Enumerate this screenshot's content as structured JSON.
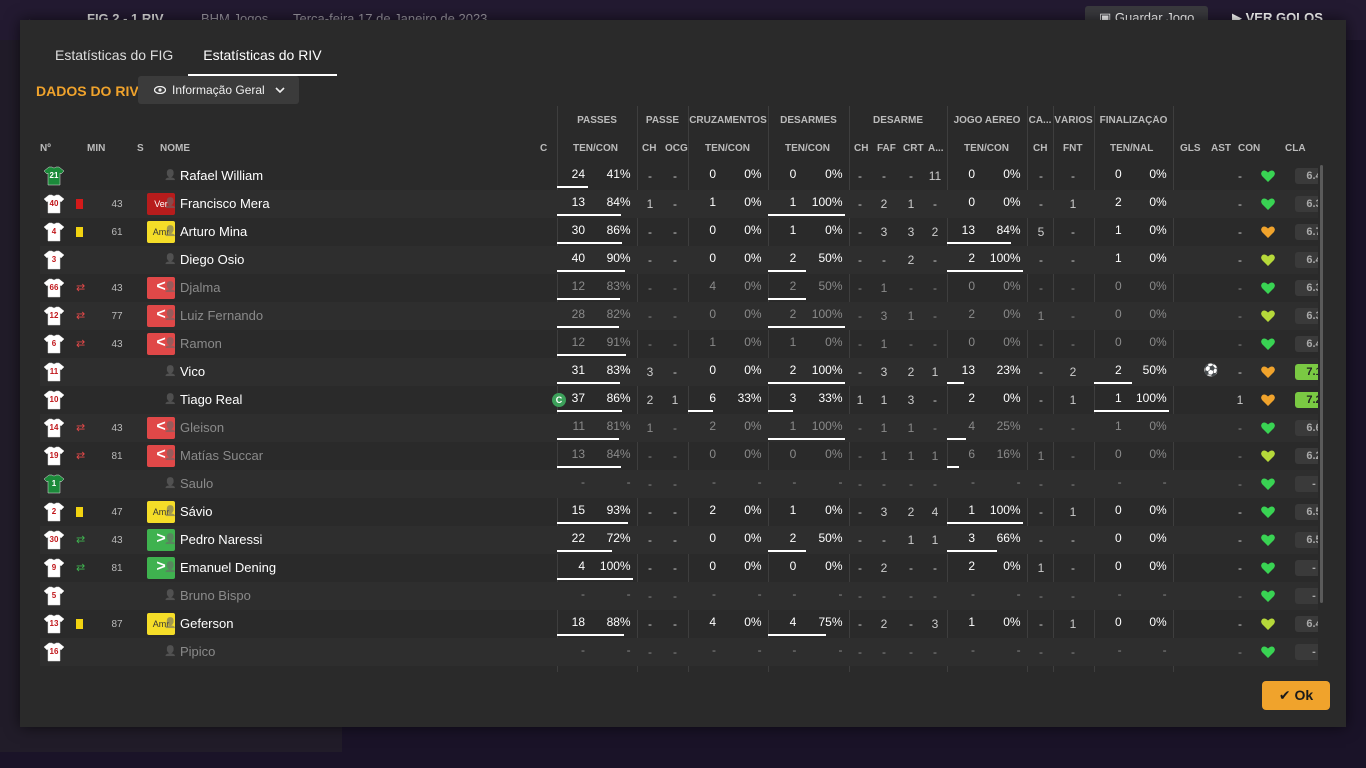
{
  "background": {
    "score": "FIG 2 - 1 RIV",
    "comp": "BHM Jogos",
    "date": "Terça-feira 17 de Janeiro de 2023",
    "save": "Guardar Jogo",
    "goals": "VER GOLOS"
  },
  "tabs": [
    "Estatísticas do FIG",
    "Estatísticas do RIV"
  ],
  "section_title": "DADOS DO RIV",
  "view_dropdown": {
    "label": "Informação Geral"
  },
  "group_headers": {
    "passes": "PASSES",
    "passe": "PASSE",
    "cruzamentos": "CRUZAMENTOS",
    "desarmes": "DESARMES",
    "desarme": "DESARME",
    "jogo_aereo": "JOGO AÉREO",
    "ca": "CA...",
    "varios": "VÁRIOS",
    "finalizacao": "FINALIZAÇÃO"
  },
  "col_headers": {
    "num": "Nº",
    "min": "MIN",
    "s": "S",
    "nome": "NOME",
    "c": "C",
    "passes_tc": "TEN/CON",
    "passe_ch": "CH",
    "passe_ocg": "OCG",
    "cruz_tc": "TEN/CON",
    "des_tc": "TEN/CON",
    "desarme_ch": "CH",
    "faf": "FAF",
    "crt": "CRT",
    "a": "A...",
    "aereo_tc": "TEN/CON",
    "ca_ch": "CH",
    "fnt": "FNT",
    "fin_tn": "TEN/NAL",
    "gls": "GLS",
    "ast": "AST",
    "con": "CON",
    "cla": "CLA"
  },
  "colors": {
    "accent": "#f0a32c",
    "heart_green": "#39d353",
    "heart_lime": "#b6d93a",
    "heart_amber": "#f0a32c"
  },
  "players": [
    {
      "num": "21",
      "gk": true,
      "card": "",
      "sub": "",
      "min": "",
      "badge": "",
      "badge_type": "",
      "name": "Rafael William",
      "dim": false,
      "capt": false,
      "p_ten": "24",
      "p_pct": "41%",
      "p_bar": 0.41,
      "pc": "-",
      "pocg": "-",
      "cr_ten": "0",
      "cr_pct": "0%",
      "cr_bar": 0,
      "de_ten": "0",
      "de_pct": "0%",
      "de_bar": 0,
      "d_ch": "-",
      "faf": "-",
      "crt": "-",
      "a": "11",
      "ae_ten": "0",
      "ae_pct": "0%",
      "ae_bar": 0,
      "ca": "-",
      "fnt": "-",
      "f_ten": "0",
      "f_pct": "0%",
      "f_bar": 0,
      "gls": "",
      "ast": "-",
      "con": "green",
      "cla": "6.4",
      "best": false
    },
    {
      "num": "40",
      "gk": false,
      "card": "red",
      "sub": "",
      "min": "43",
      "badge": "Ver",
      "badge_type": "ver",
      "name": "Francisco Mera",
      "dim": false,
      "capt": false,
      "p_ten": "13",
      "p_pct": "84%",
      "p_bar": 0.84,
      "pc": "1",
      "pocg": "-",
      "cr_ten": "1",
      "cr_pct": "0%",
      "cr_bar": 0,
      "de_ten": "1",
      "de_pct": "100%",
      "de_bar": 1,
      "d_ch": "-",
      "faf": "2",
      "crt": "1",
      "a": "-",
      "ae_ten": "0",
      "ae_pct": "0%",
      "ae_bar": 0,
      "ca": "-",
      "fnt": "1",
      "f_ten": "2",
      "f_pct": "0%",
      "f_bar": 0,
      "gls": "",
      "ast": "-",
      "con": "green",
      "cla": "6.3",
      "best": false
    },
    {
      "num": "4",
      "gk": false,
      "card": "yel",
      "sub": "",
      "min": "61",
      "badge": "Amr",
      "badge_type": "amr",
      "name": "Arturo Mina",
      "dim": false,
      "capt": false,
      "p_ten": "30",
      "p_pct": "86%",
      "p_bar": 0.86,
      "pc": "-",
      "pocg": "-",
      "cr_ten": "0",
      "cr_pct": "0%",
      "cr_bar": 0,
      "de_ten": "1",
      "de_pct": "0%",
      "de_bar": 0,
      "d_ch": "-",
      "faf": "3",
      "crt": "3",
      "a": "2",
      "ae_ten": "13",
      "ae_pct": "84%",
      "ae_bar": 0.84,
      "ca": "5",
      "fnt": "-",
      "f_ten": "1",
      "f_pct": "0%",
      "f_bar": 0,
      "gls": "",
      "ast": "-",
      "con": "amber",
      "cla": "6.7",
      "best": false
    },
    {
      "num": "3",
      "gk": false,
      "card": "",
      "sub": "",
      "min": "",
      "badge": "",
      "badge_type": "",
      "name": "Diego Osio",
      "dim": false,
      "capt": false,
      "p_ten": "40",
      "p_pct": "90%",
      "p_bar": 0.9,
      "pc": "-",
      "pocg": "-",
      "cr_ten": "0",
      "cr_pct": "0%",
      "cr_bar": 0,
      "de_ten": "2",
      "de_pct": "50%",
      "de_bar": 0.5,
      "d_ch": "-",
      "faf": "-",
      "crt": "2",
      "a": "-",
      "ae_ten": "2",
      "ae_pct": "100%",
      "ae_bar": 1,
      "ca": "-",
      "fnt": "-",
      "f_ten": "1",
      "f_pct": "0%",
      "f_bar": 0,
      "gls": "",
      "ast": "-",
      "con": "yellow",
      "cla": "6.4",
      "best": false
    },
    {
      "num": "66",
      "gk": false,
      "card": "",
      "sub": "out",
      "min": "43",
      "badge": "<",
      "badge_type": "out",
      "name": "Djalma",
      "dim": true,
      "capt": false,
      "p_ten": "12",
      "p_pct": "83%",
      "p_bar": 0.83,
      "pc": "-",
      "pocg": "-",
      "cr_ten": "4",
      "cr_pct": "0%",
      "cr_bar": 0,
      "de_ten": "2",
      "de_pct": "50%",
      "de_bar": 0.5,
      "d_ch": "-",
      "faf": "1",
      "crt": "-",
      "a": "-",
      "ae_ten": "0",
      "ae_pct": "0%",
      "ae_bar": 0,
      "ca": "-",
      "fnt": "-",
      "f_ten": "0",
      "f_pct": "0%",
      "f_bar": 0,
      "gls": "",
      "ast": "-",
      "con": "green",
      "cla": "6.3",
      "best": false
    },
    {
      "num": "12",
      "gk": false,
      "card": "",
      "sub": "out",
      "min": "77",
      "badge": "<",
      "badge_type": "out",
      "name": "Luiz Fernando",
      "dim": true,
      "capt": false,
      "p_ten": "28",
      "p_pct": "82%",
      "p_bar": 0.82,
      "pc": "-",
      "pocg": "-",
      "cr_ten": "0",
      "cr_pct": "0%",
      "cr_bar": 0,
      "de_ten": "2",
      "de_pct": "100%",
      "de_bar": 1,
      "d_ch": "-",
      "faf": "3",
      "crt": "1",
      "a": "-",
      "ae_ten": "2",
      "ae_pct": "0%",
      "ae_bar": 0,
      "ca": "1",
      "fnt": "-",
      "f_ten": "0",
      "f_pct": "0%",
      "f_bar": 0,
      "gls": "",
      "ast": "-",
      "con": "yellow",
      "cla": "6.3",
      "best": false
    },
    {
      "num": "6",
      "gk": false,
      "card": "",
      "sub": "out",
      "min": "43",
      "badge": "<",
      "badge_type": "out",
      "name": "Ramon",
      "dim": true,
      "capt": false,
      "p_ten": "12",
      "p_pct": "91%",
      "p_bar": 0.91,
      "pc": "-",
      "pocg": "-",
      "cr_ten": "1",
      "cr_pct": "0%",
      "cr_bar": 0,
      "de_ten": "1",
      "de_pct": "0%",
      "de_bar": 0,
      "d_ch": "-",
      "faf": "1",
      "crt": "-",
      "a": "-",
      "ae_ten": "0",
      "ae_pct": "0%",
      "ae_bar": 0,
      "ca": "-",
      "fnt": "-",
      "f_ten": "0",
      "f_pct": "0%",
      "f_bar": 0,
      "gls": "",
      "ast": "-",
      "con": "green",
      "cla": "6.4",
      "best": false
    },
    {
      "num": "11",
      "gk": false,
      "card": "",
      "sub": "",
      "min": "",
      "badge": "",
      "badge_type": "",
      "name": "Vico",
      "dim": false,
      "capt": false,
      "p_ten": "31",
      "p_pct": "83%",
      "p_bar": 0.83,
      "pc": "3",
      "pocg": "-",
      "cr_ten": "0",
      "cr_pct": "0%",
      "cr_bar": 0,
      "de_ten": "2",
      "de_pct": "100%",
      "de_bar": 1,
      "d_ch": "-",
      "faf": "3",
      "crt": "2",
      "a": "1",
      "ae_ten": "13",
      "ae_pct": "23%",
      "ae_bar": 0.23,
      "ca": "-",
      "fnt": "2",
      "f_ten": "2",
      "f_pct": "50%",
      "f_bar": 0.5,
      "gls": "ball",
      "ast": "-",
      "con": "amber",
      "cla": "7.1",
      "best": true
    },
    {
      "num": "10",
      "gk": false,
      "card": "",
      "sub": "",
      "min": "",
      "badge": "",
      "badge_type": "",
      "name": "Tiago Real",
      "dim": false,
      "capt": true,
      "p_ten": "37",
      "p_pct": "86%",
      "p_bar": 0.86,
      "pc": "2",
      "pocg": "1",
      "cr_ten": "6",
      "cr_pct": "33%",
      "cr_bar": 0.33,
      "de_ten": "3",
      "de_pct": "33%",
      "de_bar": 0.33,
      "d_ch": "1",
      "faf": "1",
      "crt": "3",
      "a": "-",
      "ae_ten": "2",
      "ae_pct": "0%",
      "ae_bar": 0,
      "ca": "-",
      "fnt": "1",
      "f_ten": "1",
      "f_pct": "100%",
      "f_bar": 1,
      "gls": "",
      "ast": "1",
      "con": "amber",
      "cla": "7.2",
      "best": true
    },
    {
      "num": "14",
      "gk": false,
      "card": "",
      "sub": "out",
      "min": "43",
      "badge": "<",
      "badge_type": "out",
      "name": "Gleison",
      "dim": true,
      "capt": false,
      "p_ten": "11",
      "p_pct": "81%",
      "p_bar": 0.81,
      "pc": "1",
      "pocg": "-",
      "cr_ten": "2",
      "cr_pct": "0%",
      "cr_bar": 0,
      "de_ten": "1",
      "de_pct": "100%",
      "de_bar": 1,
      "d_ch": "-",
      "faf": "1",
      "crt": "1",
      "a": "-",
      "ae_ten": "4",
      "ae_pct": "25%",
      "ae_bar": 0.25,
      "ca": "-",
      "fnt": "-",
      "f_ten": "1",
      "f_pct": "0%",
      "f_bar": 0,
      "gls": "",
      "ast": "-",
      "con": "green",
      "cla": "6.6",
      "best": false
    },
    {
      "num": "19",
      "gk": false,
      "card": "",
      "sub": "out",
      "min": "81",
      "badge": "<",
      "badge_type": "out",
      "name": "Matías Succar",
      "dim": true,
      "capt": false,
      "p_ten": "13",
      "p_pct": "84%",
      "p_bar": 0.84,
      "pc": "-",
      "pocg": "-",
      "cr_ten": "0",
      "cr_pct": "0%",
      "cr_bar": 0,
      "de_ten": "0",
      "de_pct": "0%",
      "de_bar": 0,
      "d_ch": "-",
      "faf": "1",
      "crt": "1",
      "a": "1",
      "ae_ten": "6",
      "ae_pct": "16%",
      "ae_bar": 0.16,
      "ca": "1",
      "fnt": "-",
      "f_ten": "0",
      "f_pct": "0%",
      "f_bar": 0,
      "gls": "",
      "ast": "-",
      "con": "yellow",
      "cla": "6.2",
      "best": false
    },
    {
      "num": "1",
      "gk": true,
      "card": "",
      "sub": "",
      "min": "",
      "badge": "",
      "badge_type": "",
      "name": "Saulo",
      "dim": true,
      "capt": false,
      "p_ten": "-",
      "p_pct": "-",
      "p_bar": 0,
      "pc": "-",
      "pocg": "-",
      "cr_ten": "-",
      "cr_pct": "-",
      "cr_bar": 0,
      "de_ten": "-",
      "de_pct": "-",
      "de_bar": 0,
      "d_ch": "-",
      "faf": "-",
      "crt": "-",
      "a": "-",
      "ae_ten": "-",
      "ae_pct": "-",
      "ae_bar": 0,
      "ca": "-",
      "fnt": "-",
      "f_ten": "-",
      "f_pct": "-",
      "f_bar": 0,
      "gls": "",
      "ast": "-",
      "con": "green",
      "cla": "-",
      "best": false
    },
    {
      "num": "2",
      "gk": false,
      "card": "yel",
      "sub": "",
      "min": "47",
      "badge": "Amr",
      "badge_type": "amr",
      "name": "Sávio",
      "dim": false,
      "capt": false,
      "p_ten": "15",
      "p_pct": "93%",
      "p_bar": 0.93,
      "pc": "-",
      "pocg": "-",
      "cr_ten": "2",
      "cr_pct": "0%",
      "cr_bar": 0,
      "de_ten": "1",
      "de_pct": "0%",
      "de_bar": 0,
      "d_ch": "-",
      "faf": "3",
      "crt": "2",
      "a": "4",
      "ae_ten": "1",
      "ae_pct": "100%",
      "ae_bar": 1,
      "ca": "-",
      "fnt": "1",
      "f_ten": "0",
      "f_pct": "0%",
      "f_bar": 0,
      "gls": "",
      "ast": "-",
      "con": "green",
      "cla": "6.5",
      "best": false
    },
    {
      "num": "30",
      "gk": false,
      "card": "",
      "sub": "in",
      "min": "43",
      "badge": ">",
      "badge_type": "in",
      "name": "Pedro Naressi",
      "dim": false,
      "capt": false,
      "p_ten": "22",
      "p_pct": "72%",
      "p_bar": 0.72,
      "pc": "-",
      "pocg": "-",
      "cr_ten": "0",
      "cr_pct": "0%",
      "cr_bar": 0,
      "de_ten": "2",
      "de_pct": "50%",
      "de_bar": 0.5,
      "d_ch": "-",
      "faf": "-",
      "crt": "1",
      "a": "1",
      "ae_ten": "3",
      "ae_pct": "66%",
      "ae_bar": 0.66,
      "ca": "-",
      "fnt": "-",
      "f_ten": "0",
      "f_pct": "0%",
      "f_bar": 0,
      "gls": "",
      "ast": "-",
      "con": "green",
      "cla": "6.5",
      "best": false
    },
    {
      "num": "9",
      "gk": false,
      "card": "",
      "sub": "in",
      "min": "81",
      "badge": ">",
      "badge_type": "in",
      "name": "Emanuel Dening",
      "dim": false,
      "capt": false,
      "p_ten": "4",
      "p_pct": "100%",
      "p_bar": 1,
      "pc": "-",
      "pocg": "-",
      "cr_ten": "0",
      "cr_pct": "0%",
      "cr_bar": 0,
      "de_ten": "0",
      "de_pct": "0%",
      "de_bar": 0,
      "d_ch": "-",
      "faf": "2",
      "crt": "-",
      "a": "-",
      "ae_ten": "2",
      "ae_pct": "0%",
      "ae_bar": 0,
      "ca": "1",
      "fnt": "-",
      "f_ten": "0",
      "f_pct": "0%",
      "f_bar": 0,
      "gls": "",
      "ast": "-",
      "con": "green",
      "cla": "-",
      "best": false
    },
    {
      "num": "5",
      "gk": false,
      "card": "",
      "sub": "",
      "min": "",
      "badge": "",
      "badge_type": "",
      "name": "Bruno Bispo",
      "dim": true,
      "capt": false,
      "p_ten": "-",
      "p_pct": "-",
      "p_bar": 0,
      "pc": "-",
      "pocg": "-",
      "cr_ten": "-",
      "cr_pct": "-",
      "cr_bar": 0,
      "de_ten": "-",
      "de_pct": "-",
      "de_bar": 0,
      "d_ch": "-",
      "faf": "-",
      "crt": "-",
      "a": "-",
      "ae_ten": "-",
      "ae_pct": "-",
      "ae_bar": 0,
      "ca": "-",
      "fnt": "-",
      "f_ten": "-",
      "f_pct": "-",
      "f_bar": 0,
      "gls": "",
      "ast": "-",
      "con": "green",
      "cla": "-",
      "best": false
    },
    {
      "num": "13",
      "gk": false,
      "card": "yel",
      "sub": "",
      "min": "87",
      "badge": "Amr",
      "badge_type": "amr",
      "name": "Geferson",
      "dim": false,
      "capt": false,
      "p_ten": "18",
      "p_pct": "88%",
      "p_bar": 0.88,
      "pc": "-",
      "pocg": "-",
      "cr_ten": "4",
      "cr_pct": "0%",
      "cr_bar": 0,
      "de_ten": "4",
      "de_pct": "75%",
      "de_bar": 0.75,
      "d_ch": "-",
      "faf": "2",
      "crt": "-",
      "a": "3",
      "ae_ten": "1",
      "ae_pct": "0%",
      "ae_bar": 0,
      "ca": "-",
      "fnt": "1",
      "f_ten": "0",
      "f_pct": "0%",
      "f_bar": 0,
      "gls": "",
      "ast": "-",
      "con": "yellow",
      "cla": "6.4",
      "best": false
    },
    {
      "num": "16",
      "gk": false,
      "card": "",
      "sub": "",
      "min": "",
      "badge": "",
      "badge_type": "",
      "name": "Pipico",
      "dim": true,
      "capt": false,
      "p_ten": "-",
      "p_pct": "-",
      "p_bar": 0,
      "pc": "-",
      "pocg": "-",
      "cr_ten": "-",
      "cr_pct": "-",
      "cr_bar": 0,
      "de_ten": "-",
      "de_pct": "-",
      "de_bar": 0,
      "d_ch": "-",
      "faf": "-",
      "crt": "-",
      "a": "-",
      "ae_ten": "-",
      "ae_pct": "-",
      "ae_bar": 0,
      "ca": "-",
      "fnt": "-",
      "f_ten": "-",
      "f_pct": "-",
      "f_bar": 0,
      "gls": "",
      "ast": "-",
      "con": "green",
      "cla": "-",
      "best": false
    }
  ],
  "ok_button": "Ok"
}
